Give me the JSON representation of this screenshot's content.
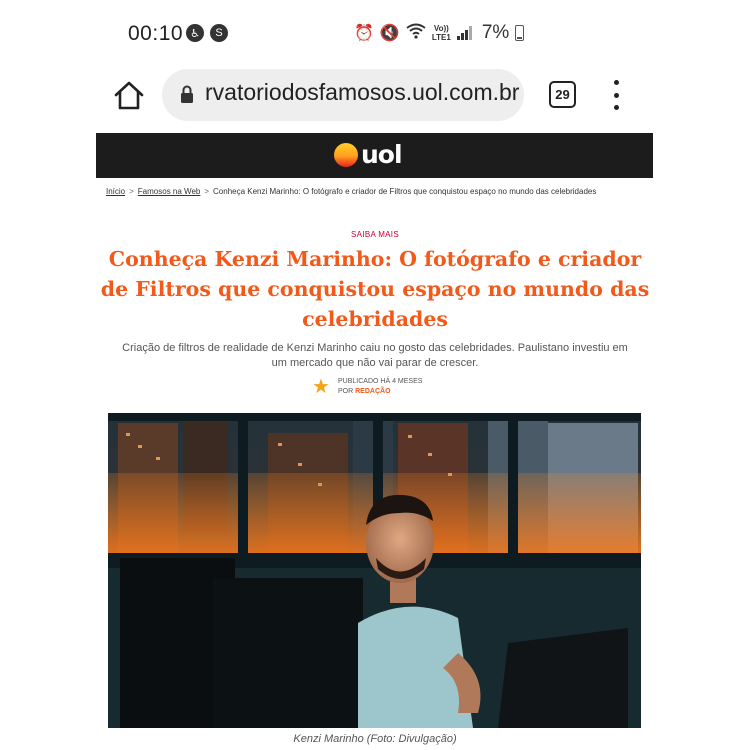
{
  "status_bar": {
    "time": "00:10",
    "left_icons": [
      "accessibility-icon",
      "shazam-icon"
    ],
    "right_icons": [
      "alarm-icon",
      "mute-icon",
      "wifi-icon",
      "volte-lte-icon",
      "signal-icon"
    ],
    "volte_label": "Vo))",
    "lte_label": "LTE1",
    "battery": "7%"
  },
  "browser": {
    "url": "rvatoriodosfamosos.uol.com.br",
    "tab_count": "29"
  },
  "site": {
    "logo_text": "uol",
    "brand_color": "#f15a1a"
  },
  "breadcrumb": {
    "items": [
      "Início",
      "Famosos na Web",
      "Conheça Kenzi Marinho: O fotógrafo e criador de Filtros que conquistou espaço no mundo das celebridades"
    ],
    "separator": ">"
  },
  "article": {
    "kicker": "SAIBA MAIS",
    "headline": "Conheça Kenzi Marinho: O fotógrafo e criador de Filtros que conquistou espaço no mundo das celebridades",
    "subtitle": "Criação de filtros de realidade de Kenzi Marinho caiu no gosto das celebridades. Paulistano investiu em um mercado que não vai parar de crescer.",
    "published": "PUBLICADO HÁ 4 MESES",
    "by_prefix": "POR ",
    "author": "REDAÇÃO",
    "image_caption": "Kenzi Marinho (Foto: Divulgação)"
  }
}
